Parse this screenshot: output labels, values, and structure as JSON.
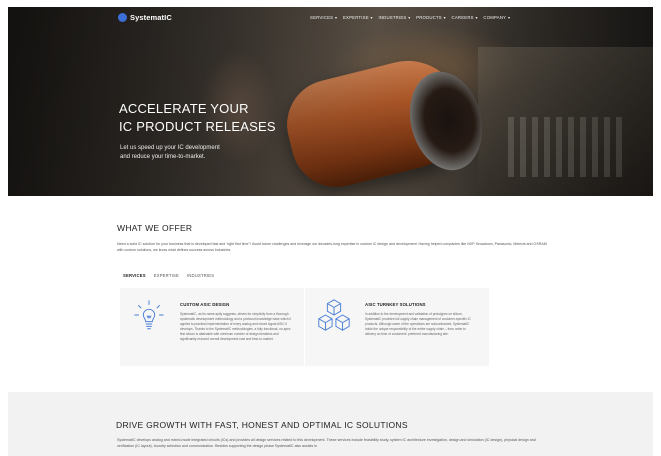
{
  "header": {
    "logo_text": "SystematIC",
    "nav": [
      {
        "label": "SERVICES",
        "has_dropdown": true
      },
      {
        "label": "EXPERTISE",
        "has_dropdown": true
      },
      {
        "label": "INDUSTRIES",
        "has_dropdown": true
      },
      {
        "label": "PRODUCTS",
        "has_dropdown": true
      },
      {
        "label": "CAREERS",
        "has_dropdown": true
      },
      {
        "label": "COMPANY",
        "has_dropdown": true
      }
    ]
  },
  "hero": {
    "title_line1": "ACCELERATE YOUR",
    "title_line2": "IC PRODUCT RELEASES",
    "subtitle_line1": "Let us speed up your IC development",
    "subtitle_line2": "and reduce your time-to-market."
  },
  "offer": {
    "title": "WHAT WE OFFER",
    "description": "Need a solid IC solution for your business that is developed fast and 'right first time'? Avoid future challenges and leverage our decades-long expertise in custom IC design and development. Having helped companies like NXP, Broadcom, Panasonic, Melexis and OSRAM with custom solutions, we know what defines success across industries.",
    "tabs": [
      {
        "label": "SERVICES",
        "active": true
      },
      {
        "label": "EXPERTISE",
        "active": false
      },
      {
        "label": "INDUSTRIES",
        "active": false
      }
    ],
    "cards": [
      {
        "icon": "lightbulb-icon",
        "title": "CUSTOM ASIC DESIGN",
        "text": "SystematIC, as its name aptly suggests, strives for simplicity from a thorough systematic development methodology and a profound knowledge base which it applies to practical implementation of every analog and mixed signal ASIC it develops. Thanks to the SystematIC methodologies, a fully functional, on-spec first silicon is attainable with minimum number of design iterations and significantly reduced overall development cost and time-to-market."
      },
      {
        "icon": "cubes-icon",
        "title": "ASIC TURNKEY SOLUTIONS",
        "text": "In addition to the development and validation of prototypes on silicon, SystematIC provides full supply chain management of customer-specific IC products. Although some of the operations are subcontracted, SystematIC holds the unique responsibility of the entire supply chain – from order to delivery on time of customers' preferred manufacturing site."
      }
    ]
  },
  "growth": {
    "title": "DRIVE GROWTH WITH FAST, HONEST AND OPTIMAL IC SOLUTIONS",
    "description": "SystematIC develops analog and mixed-mode integrated circuits (ICs) and provides all design services related to this development. These services include feasibility study, system IC architecture investigation, design and simulation (IC design), physical design and verification (IC layout), foundry selection and communication. Besides supporting the design phase SystematIC also assists in"
  },
  "colors": {
    "brand_blue": "#3d6fd9",
    "card_bg": "#f6f6f6",
    "icon_blue": "#4a7fd6",
    "section_bg": "#f2f2f2"
  }
}
